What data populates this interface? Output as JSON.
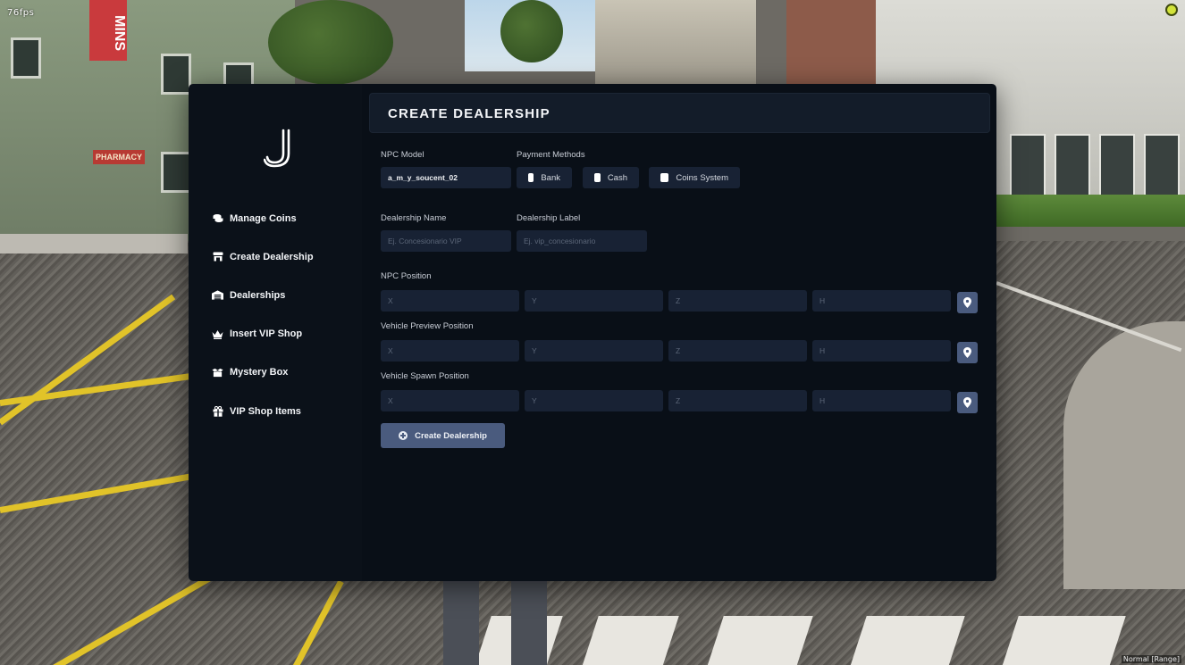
{
  "hud": {
    "fps": "76fps",
    "mode": "Normal [Range]"
  },
  "scenery": {
    "sign_text": "MINS",
    "pharmacy_text": "PHARMACY"
  },
  "sidebar": {
    "logo_icon": "j-logo-icon",
    "items": [
      {
        "label": "Manage Coins",
        "icon": "coins-icon"
      },
      {
        "label": "Create Dealership",
        "icon": "store-icon"
      },
      {
        "label": "Dealerships",
        "icon": "warehouse-icon"
      },
      {
        "label": "Insert VIP Shop",
        "icon": "crown-icon"
      },
      {
        "label": "Mystery Box",
        "icon": "box-open-icon"
      },
      {
        "label": "VIP Shop Items",
        "icon": "gift-icon"
      }
    ]
  },
  "main": {
    "title": "CREATE DEALERSHIP",
    "npc_model": {
      "label": "NPC Model",
      "value": "a_m_y_soucent_02"
    },
    "payment": {
      "label": "Payment Methods",
      "options": [
        {
          "label": "Bank",
          "checked": false
        },
        {
          "label": "Cash",
          "checked": false
        },
        {
          "label": "Coins System",
          "checked": false
        }
      ]
    },
    "dealership_name": {
      "label": "Dealership Name",
      "placeholder": "Ej. Concesionario VIP"
    },
    "dealership_label": {
      "label": "Dealership Label",
      "placeholder": "Ej. vip_concesionario"
    },
    "positions": [
      {
        "label": "NPC Position",
        "placeholders": [
          "X",
          "Y",
          "Z",
          "H"
        ]
      },
      {
        "label": "Vehicle Preview Position",
        "placeholders": [
          "X",
          "Y",
          "Z",
          "H"
        ]
      },
      {
        "label": "Vehicle Spawn Position",
        "placeholders": [
          "X",
          "Y",
          "Z",
          "H"
        ]
      }
    ],
    "submit_label": "Create Dealership"
  },
  "colors": {
    "sidebar_bg": "#0b1119",
    "main_bg": "#090f17",
    "field_bg": "#182234",
    "accent": "#4a5b7e",
    "text": "#f3f5f8"
  }
}
